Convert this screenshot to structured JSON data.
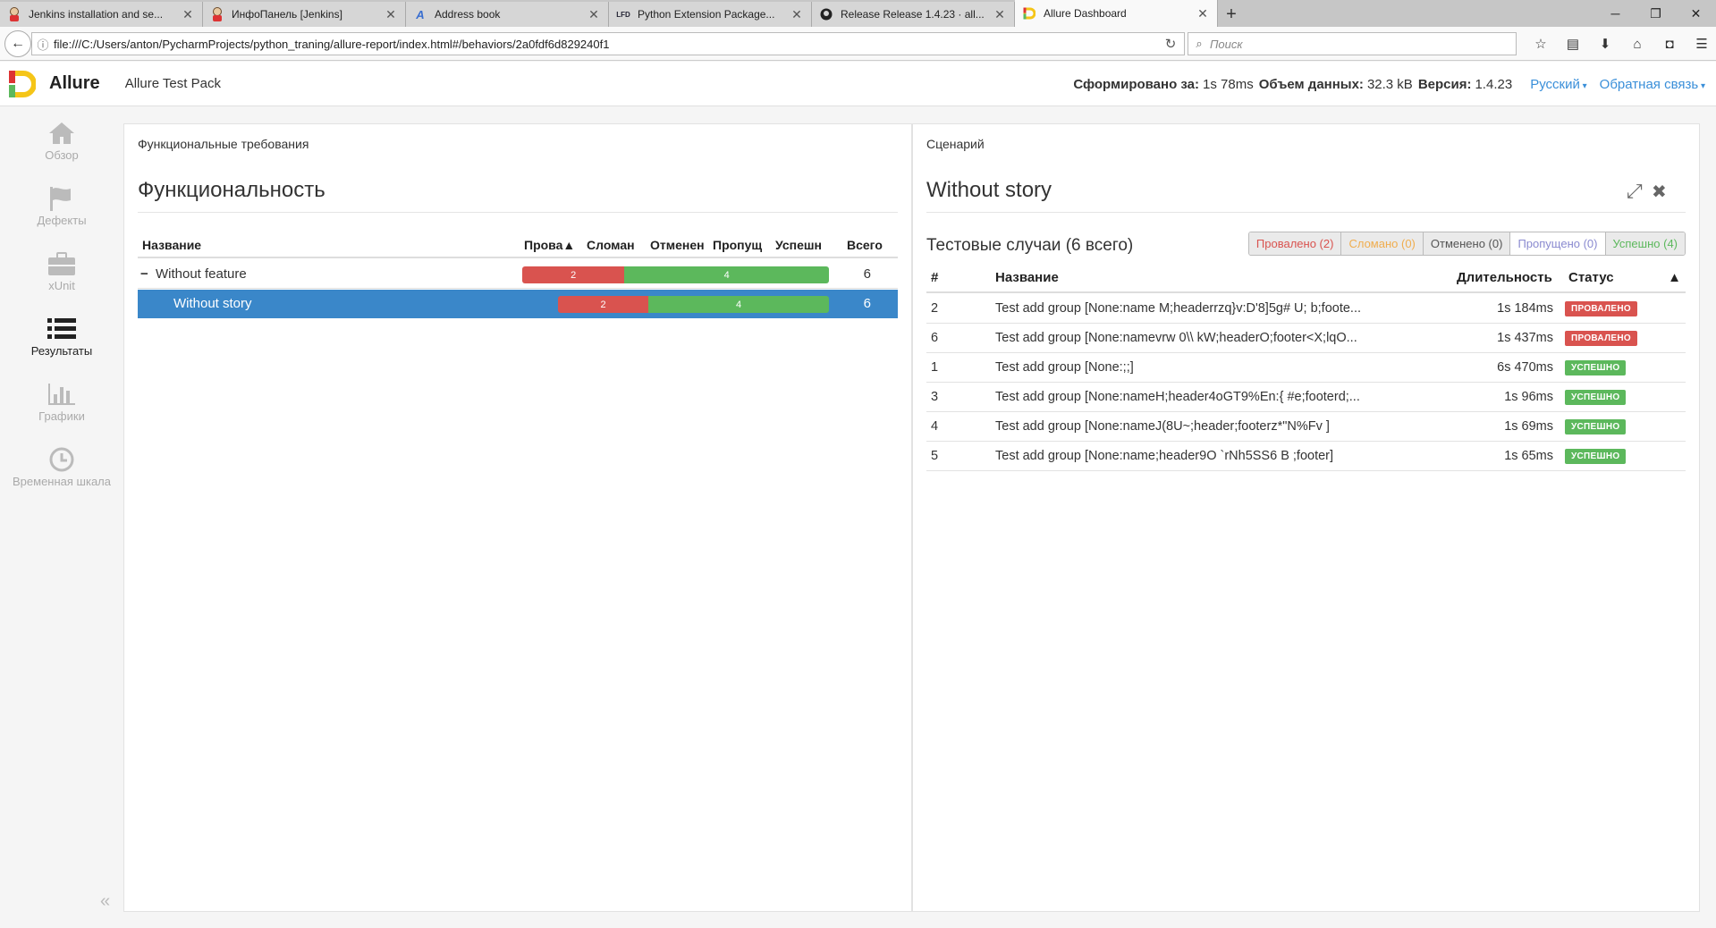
{
  "browser": {
    "tabs": [
      {
        "title": "Jenkins installation and se...",
        "icon": "jenkins-icon",
        "active": false
      },
      {
        "title": "ИнфоПанель [Jenkins]",
        "icon": "jenkins-icon",
        "active": false
      },
      {
        "title": "Address book",
        "icon": "address-book-icon",
        "active": false
      },
      {
        "title": "Python Extension Package...",
        "icon": "lfd-icon",
        "favtext": "LFD",
        "active": false
      },
      {
        "title": "Release Release 1.4.23 · all...",
        "icon": "github-icon",
        "active": false
      },
      {
        "title": "Allure Dashboard",
        "icon": "allure-icon",
        "active": true
      }
    ],
    "url": "file:///C:/Users/anton/PycharmProjects/python_traning/allure-report/index.html#/behaviors/2a0fdf6d829240f1",
    "search_placeholder": "Поиск"
  },
  "header": {
    "brand": "Allure",
    "pack_name": "Allure Test Pack",
    "generated_label": "Сформировано за:",
    "generated_value": "1s 78ms",
    "size_label": "Объем данных:",
    "size_value": "32.3 kB",
    "version_label": "Версия:",
    "version_value": "1.4.23",
    "language": "Русский",
    "feedback": "Обратная связь"
  },
  "sidebar": {
    "items": [
      {
        "label": "Обзор",
        "icon": "home-icon",
        "active": false
      },
      {
        "label": "Дефекты",
        "icon": "flag-icon",
        "active": false
      },
      {
        "label": "xUnit",
        "icon": "briefcase-icon",
        "active": false
      },
      {
        "label": "Результаты",
        "icon": "list-icon",
        "active": true
      },
      {
        "label": "Графики",
        "icon": "bar-chart-icon",
        "active": false
      },
      {
        "label": "Временная шкала",
        "icon": "clock-icon",
        "active": false
      }
    ]
  },
  "left_pane": {
    "breadcrumb": "Функциональные требования",
    "title": "Функциональность",
    "columns": [
      "Название",
      "Прова▲",
      "Сломан",
      "Отменен",
      "Пропущ",
      "Успешн",
      "Всего"
    ],
    "rows": [
      {
        "name": "Without feature",
        "expander": "−",
        "failed": 2,
        "passed": 4,
        "total": "6",
        "selected": false
      },
      {
        "name": "Without story",
        "failed": 2,
        "passed": 4,
        "total": "6",
        "selected": true
      }
    ]
  },
  "right_pane": {
    "breadcrumb": "Сценарий",
    "title": "Without story",
    "subtitle": "Тестовые случаи (6 всего)",
    "filters": [
      {
        "label": "Провалено (2)",
        "color": "#d9534f"
      },
      {
        "label": "Сломано (0)",
        "color": "#f0ad4e"
      },
      {
        "label": "Отменено (0)",
        "color": "#555555"
      },
      {
        "label": "Пропущено (0)",
        "color": "#8a8ad0"
      },
      {
        "label": "Успешно (4)",
        "color": "#5cb85c"
      }
    ],
    "columns": {
      "num": "#",
      "name": "Название",
      "duration": "Длительность",
      "status": "Статус",
      "sort": "▲"
    },
    "cases": [
      {
        "num": "2",
        "name": "Test add group [None:name M;headerrzq}v:D'8]5g# U; b;foote...",
        "duration": "1s 184ms",
        "status": "ПРОВАЛЕНО",
        "status_color": "#d9534f"
      },
      {
        "num": "6",
        "name": "Test add group [None:namevrw 0\\\\ kW;headerO;footer<X;lqO...",
        "duration": "1s 437ms",
        "status": "ПРОВАЛЕНО",
        "status_color": "#d9534f"
      },
      {
        "num": "1",
        "name": "Test add group [None:;;]",
        "duration": "6s 470ms",
        "status": "УСПЕШНО",
        "status_color": "#5cb85c"
      },
      {
        "num": "3",
        "name": "Test add group [None:nameH;header4oGT9%En:{ #e;footerd;...",
        "duration": "1s 96ms",
        "status": "УСПЕШНО",
        "status_color": "#5cb85c"
      },
      {
        "num": "4",
        "name": "Test add group [None:nameJ(8U~;header;footerz*\"N%Fv ]",
        "duration": "1s 69ms",
        "status": "УСПЕШНО",
        "status_color": "#5cb85c"
      },
      {
        "num": "5",
        "name": "Test add group [None:name;header9O `rNh5SS6 B ;footer]",
        "duration": "1s 65ms",
        "status": "УСПЕШНО",
        "status_color": "#5cb85c"
      }
    ]
  }
}
